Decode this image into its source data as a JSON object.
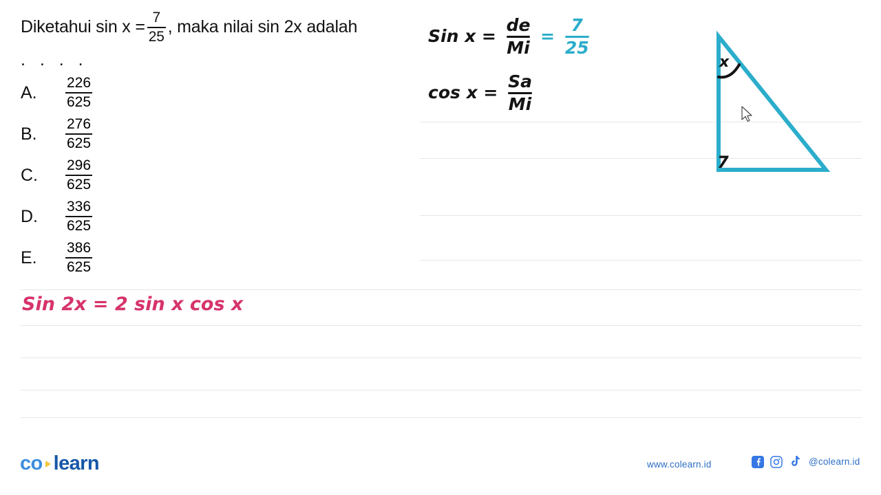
{
  "question": {
    "prefix": "Diketahui sin x =",
    "fraction": {
      "numerator": "7",
      "denominator": "25"
    },
    "suffix": ", maka nilai sin 2x adalah",
    "ellipsis": ". . . ."
  },
  "options": [
    {
      "letter": "A.",
      "numerator": "226",
      "denominator": "625"
    },
    {
      "letter": "B.",
      "numerator": "276",
      "denominator": "625"
    },
    {
      "letter": "C.",
      "numerator": "296",
      "denominator": "625"
    },
    {
      "letter": "D.",
      "numerator": "336",
      "denominator": "625"
    },
    {
      "letter": "E.",
      "numerator": "386",
      "denominator": "625"
    }
  ],
  "handwriting": {
    "sin_line": {
      "lhs": "Sin x  =",
      "fraction": {
        "numerator": "de",
        "denominator": "Mi"
      },
      "equals": "=",
      "value_fraction": {
        "numerator": "7",
        "denominator": "25"
      },
      "value_color": "#2BADCB"
    },
    "cos_line": {
      "lhs": "cos x  =",
      "fraction": {
        "numerator": "Sa",
        "denominator": "Mi"
      }
    },
    "identity": {
      "text": "Sin 2x  =  2 sin x cos x",
      "color": "#D6336C"
    }
  },
  "figure": {
    "angle_label": "x",
    "side_label": "7",
    "stroke_color": "#2BADCB"
  },
  "footer": {
    "logo": {
      "part1": "co",
      "part2": "learn"
    },
    "website": "www.colearn.id",
    "handle": "@colearn.id",
    "social": [
      "facebook-icon",
      "instagram-icon",
      "tiktok-icon"
    ]
  }
}
